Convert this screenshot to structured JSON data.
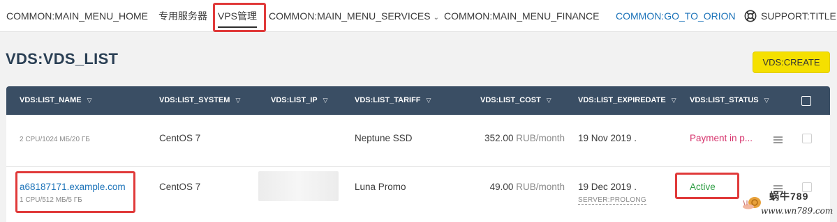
{
  "nav": {
    "home": "COMMON:MAIN_MENU_HOME",
    "dedicated": "专用服务器",
    "vps": "VPS管理",
    "services": "COMMON:MAIN_MENU_SERVICES",
    "finance": "COMMON:MAIN_MENU_FINANCE",
    "orion": "COMMON:GO_TO_ORION",
    "support": "SUPPORT:TITLE"
  },
  "page": {
    "title": "VDS:VDS_LIST",
    "create_label": "VDS:CREATE"
  },
  "table": {
    "columns": {
      "name": "VDS:LIST_NAME",
      "system": "VDS:LIST_SYSTEM",
      "ip": "VDS:LIST_IP",
      "tariff": "VDS:LIST_TARIFF",
      "cost": "VDS:LIST_COST",
      "expiredate": "VDS:LIST_EXPIREDATE",
      "status": "VDS:LIST_STATUS"
    },
    "rows": [
      {
        "name": "",
        "spec": "2 CPU/1024 МБ/20 ГБ",
        "system": "CentOS 7",
        "ip": "",
        "tariff": "Neptune SSD",
        "cost": "352.00",
        "unit": "RUB/month",
        "expire": "19 Nov 2019 .",
        "status": "Payment in p..."
      },
      {
        "name": "a68187171.example.com",
        "spec": "1 CPU/512 МБ/5 ГБ",
        "system": "CentOS 7",
        "ip": "",
        "tariff": "Luna Promo",
        "cost": "49.00",
        "unit": "RUB/month",
        "expire": "19 Dec 2019 .",
        "prolong": "SERVER:PROLONG",
        "status": "Active"
      }
    ]
  },
  "watermark": {
    "cn": "蜗牛789",
    "url": "www.wn789.com"
  },
  "colors": {
    "header_bg": "#3a4e64",
    "create_button": "#f5e000",
    "link": "#1c73b9",
    "status_payment": "#d6336c",
    "status_active": "#2f9e44",
    "highlight_box": "#e03a3a"
  },
  "icons": {
    "support": "lifebuoy-icon",
    "filter": "funnel-icon",
    "row_menu": "hamburger-icon",
    "services_dropdown": "chevron-down-icon"
  }
}
